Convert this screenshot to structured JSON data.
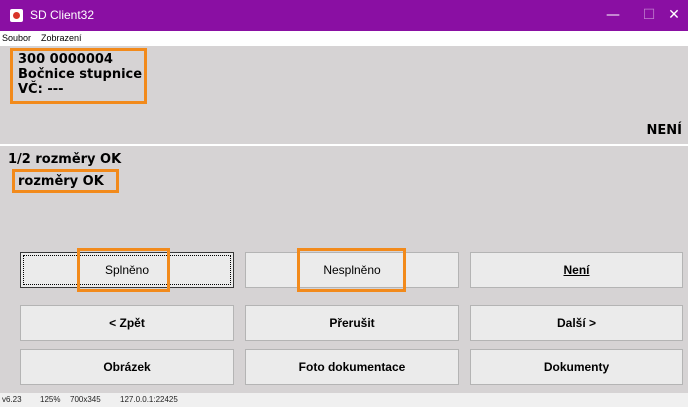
{
  "window": {
    "title": "SD Client32",
    "minimize": "—",
    "maximize": "☐",
    "close": "✕"
  },
  "menu": {
    "file": "Soubor",
    "view": "Zobrazení"
  },
  "part": {
    "number": "300 0000004",
    "name": "Bočnice stupnice",
    "serial": "VČ: ---"
  },
  "status": "NENÍ",
  "dimensions": {
    "summary": "1/2 rozměry OK",
    "status": "rozměry OK"
  },
  "buttons": {
    "fulfilled": "Splněno",
    "not_fulfilled": "Nesplněno",
    "not_present": "Není",
    "back": "< Zpět",
    "interrupt": "Přerušit",
    "next": "Další >",
    "image": "Obrázek",
    "photo_docs": "Foto dokumentace",
    "documents": "Dokumenty"
  },
  "statusbar": {
    "version": "v6.23",
    "zoom": "125%",
    "resolution": "700x345",
    "address": "127.0.0.1:22425"
  },
  "colors": {
    "titlebar": "#8a0fa3",
    "panel": "#d6d3d4",
    "highlight": "#f28a1b"
  }
}
